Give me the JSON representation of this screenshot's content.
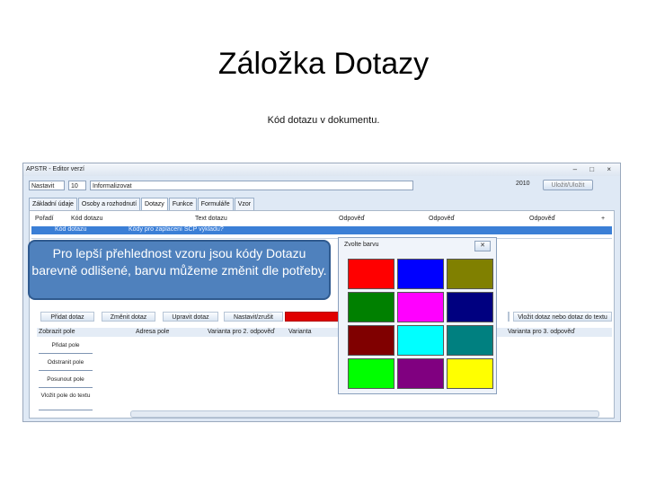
{
  "slide": {
    "title": "Záložka Dotazy",
    "subtitle": "Kód dotazu v dokumentu."
  },
  "window": {
    "title": "APSTR - Editor verzí",
    "controls": "– □ ×"
  },
  "toolbar": {
    "field1": "Nastavit",
    "field2": "10",
    "field3": "Informalizovat",
    "year": "2010",
    "button": "Uložit/Uložit"
  },
  "tabs": [
    {
      "label": "Základní údaje",
      "active": false
    },
    {
      "label": "Osoby a rozhodnutí",
      "active": false
    },
    {
      "label": "Dotazy",
      "active": true
    },
    {
      "label": "Funkce",
      "active": false
    },
    {
      "label": "Formuláře",
      "active": false
    },
    {
      "label": "Vzor",
      "active": false
    }
  ],
  "grid": {
    "headers": [
      "Pořadí",
      "Kód dotazu",
      "Text dotazu",
      "Odpověď",
      "Odpověď",
      "Odpověď",
      "+"
    ],
    "selected_row": [
      "Kód dotazu",
      "Kódy pro zaplacení SCP výkladu?"
    ]
  },
  "row_buttons": [
    "Přidat dotaz",
    "Změnit dotaz",
    "Upravit dotaz",
    "Nastavit/zrušit",
    "",
    "Vložit dotaz",
    "Vložit dotaz nebo dotaz do textu"
  ],
  "subgrid": {
    "headers": [
      "Zobrazit pole",
      "Adresa pole",
      "Varianta pro 2. odpověď",
      "Varianta",
      "Varianta pro 3. odpověď"
    ]
  },
  "side_list": [
    "Přidat pole",
    "Odstranit pole",
    "Posunout pole",
    "Vložit pole do textu"
  ],
  "callout": {
    "text": "Pro lepší přehlednost vzoru jsou kódy Dotazu barevně odlišené, barvu můžeme změnit dle potřeby."
  },
  "color_dialog": {
    "title": "Zvolte barvu",
    "close": "✕",
    "swatches": [
      "#ff0000",
      "#0000ff",
      "#808000",
      "#008000",
      "#ff00ff",
      "#000080",
      "#800000",
      "#00ffff",
      "#008080",
      "#00ff00",
      "#800080",
      "#ffff00"
    ]
  }
}
